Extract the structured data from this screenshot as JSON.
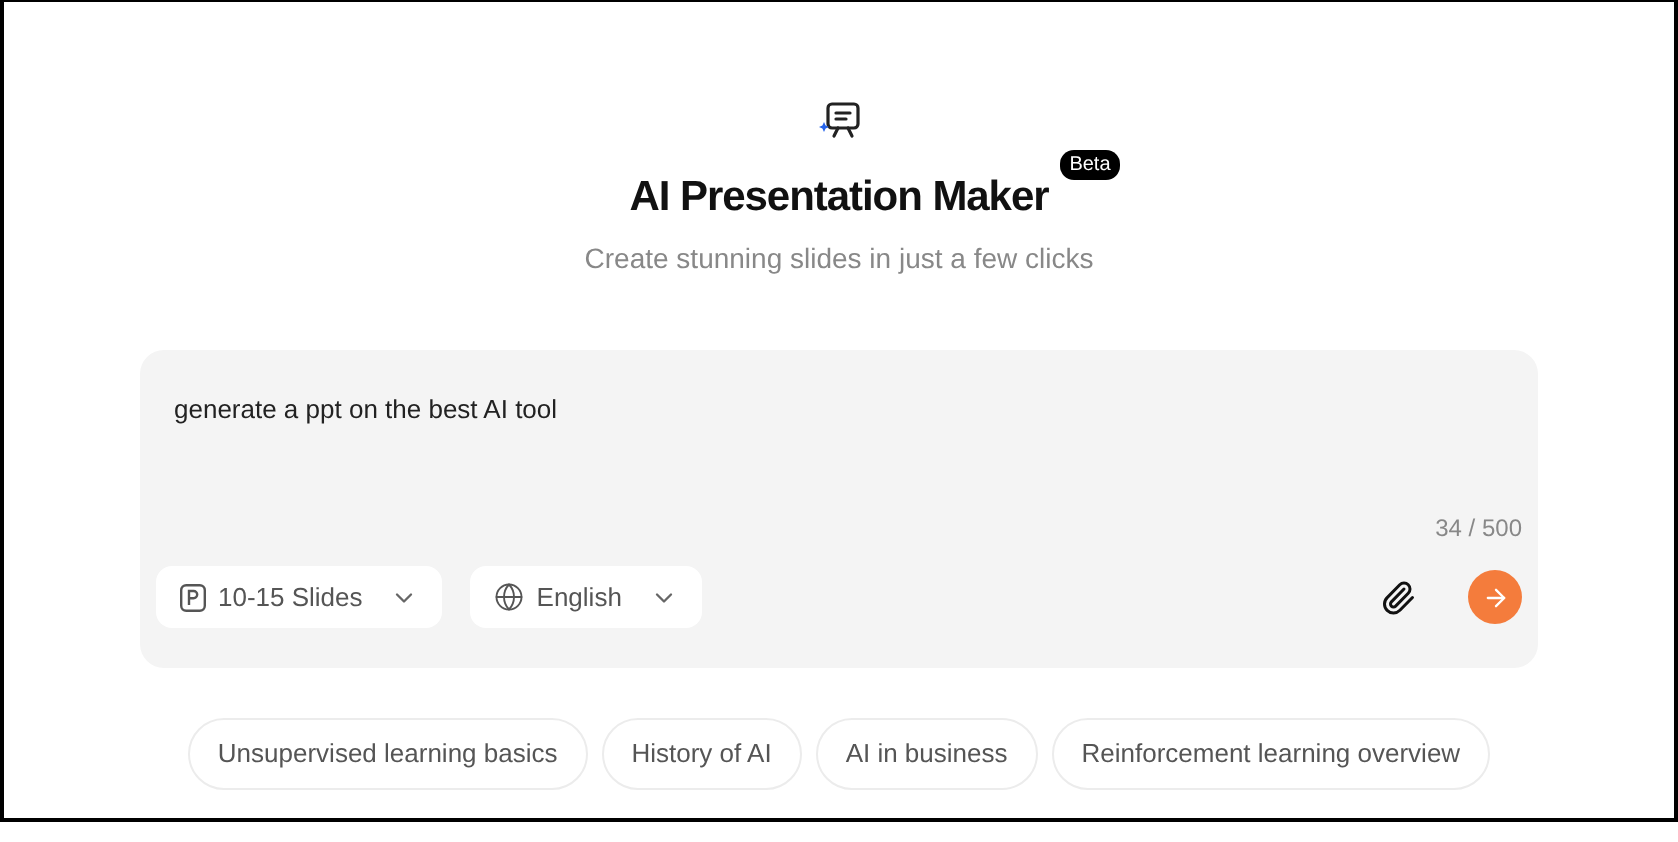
{
  "title": "AI Presentation Maker",
  "badge": "Beta",
  "subtitle": "Create stunning slides in just a few clicks",
  "prompt": {
    "value": "generate a ppt on the best AI tool",
    "counter": "34 / 500"
  },
  "selects": [
    {
      "kind": "slides",
      "label": "10-15 Slides"
    },
    {
      "kind": "language",
      "label": "English"
    }
  ],
  "suggestions": [
    "Unsupervised learning basics",
    "History of AI",
    "AI in business",
    "Reinforcement learning overview"
  ]
}
